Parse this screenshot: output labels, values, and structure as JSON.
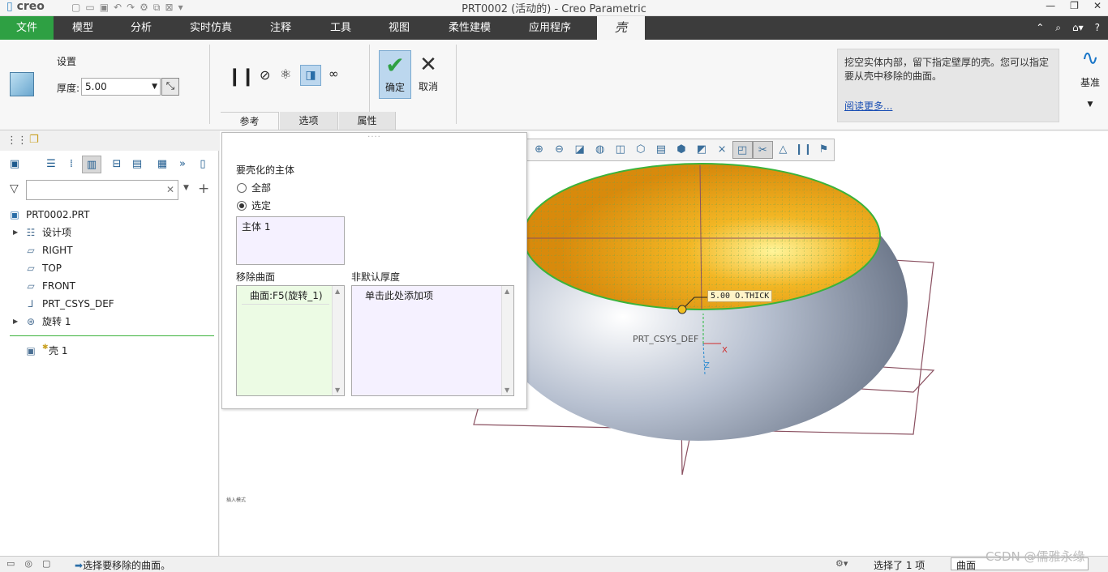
{
  "titlebar": {
    "logo": "creo",
    "title": "PRT0002 (活动的) - Creo Parametric",
    "min": "—",
    "restore": "❐",
    "close": "✕"
  },
  "menubar": {
    "items": [
      "文件",
      "模型",
      "分析",
      "实时仿真",
      "注释",
      "工具",
      "视图",
      "柔性建模",
      "应用程序",
      "壳"
    ]
  },
  "ribbon": {
    "settings_label": "设置",
    "thickness_label": "厚度:",
    "thickness_value": "5.00",
    "ok_label": "确定",
    "cancel_label": "取消",
    "tabs": [
      "参考",
      "选项",
      "属性"
    ],
    "help_text": "挖空实体内部，留下指定壁厚的壳。您可以指定要从壳中移除的曲面。",
    "help_link": "阅读更多...",
    "datum_label": "基准"
  },
  "left": {
    "filter_placeholder": "",
    "tree": [
      {
        "label": "PRT0002.PRT"
      },
      {
        "label": "设计项"
      },
      {
        "label": "RIGHT"
      },
      {
        "label": "TOP"
      },
      {
        "label": "FRONT"
      },
      {
        "label": "PRT_CSYS_DEF"
      },
      {
        "label": "旋转 1"
      },
      {
        "label": "壳 1"
      }
    ]
  },
  "panel": {
    "title": "要壳化的主体",
    "radio_all": "全部",
    "radio_selected": "选定",
    "body_item": "主体 1",
    "remove_label": "移除曲面",
    "remove_item": "曲面:F5(旋转_1)",
    "nondefault_label": "非默认厚度",
    "nondefault_item": "单击此处添加项"
  },
  "viewport": {
    "csys_label": "PRT_CSYS_DEF",
    "dim_label": "5.00 O.THICK",
    "mode_label": "插入模式",
    "axis_x": "X",
    "axis_z": "Z"
  },
  "status": {
    "message": "选择要移除的曲面。",
    "selected": "选择了 1 项",
    "filter": "曲面"
  },
  "watermark": "CSDN @儒雅永缘",
  "colors": {
    "accent": "#2ea043",
    "menubar": "#3c3c3c",
    "selection": "#bcd7ee",
    "shell_inner": "#e8a010",
    "shell_outer": "#9aa6b8"
  }
}
